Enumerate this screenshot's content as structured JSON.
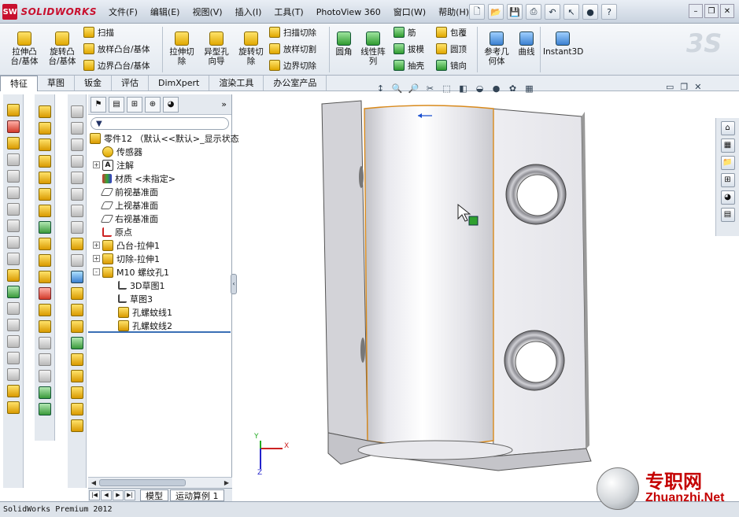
{
  "app": {
    "logo_text": "SOLIDWORKS",
    "logo_mark": "SW",
    "status": "SolidWorks Premium 2012"
  },
  "menu": [
    "文件(F)",
    "编辑(E)",
    "视图(V)",
    "插入(I)",
    "工具(T)",
    "PhotoView 360",
    "窗口(W)",
    "帮助(H)"
  ],
  "ribbon": {
    "extrude_boss": "拉伸凸\n台/基体",
    "revolve_boss": "旋转凸\n台/基体",
    "sweep": "扫描",
    "loft_boss": "放样凸台/基体",
    "boundary_boss": "边界凸台/基体",
    "extrude_cut": "拉伸切\n除",
    "hole_wizard": "异型孔\n向导",
    "revolve_cut": "旋转切\n除",
    "swept_cut": "扫描切除",
    "lofted_cut": "放样切割",
    "boundary_cut": "边界切除",
    "fillet": "圆角",
    "linear_pattern": "线性阵\n列",
    "rib": "筋",
    "draft": "拔模",
    "shell": "抽壳",
    "wrap": "包覆",
    "dome": "圆顶",
    "mirror": "镜向",
    "ref_geometry": "参考几\n何体",
    "curves": "曲线",
    "instant3d": "Instant3D"
  },
  "tabs": [
    "特征",
    "草图",
    "钣金",
    "评估",
    "DimXpert",
    "渲染工具",
    "办公室产品"
  ],
  "tree": {
    "root": "零件12 （默认<<默认>_显示状态",
    "items": [
      {
        "label": "传感器",
        "icon": "sensor-icon",
        "expander": ""
      },
      {
        "label": "注解",
        "icon": "annotation-icon",
        "expander": "+"
      },
      {
        "label": "材质 <未指定>",
        "icon": "material-icon",
        "expander": ""
      },
      {
        "label": "前视基准面",
        "icon": "plane-icon",
        "expander": ""
      },
      {
        "label": "上视基准面",
        "icon": "plane-icon",
        "expander": ""
      },
      {
        "label": "右视基准面",
        "icon": "plane-icon",
        "expander": ""
      },
      {
        "label": "原点",
        "icon": "origin-icon",
        "expander": ""
      },
      {
        "label": "凸台-拉伸1",
        "icon": "boss-extrude-icon",
        "expander": "+"
      },
      {
        "label": "切除-拉伸1",
        "icon": "cut-extrude-icon",
        "expander": "+"
      },
      {
        "label": "M10 螺纹孔1",
        "icon": "hole-icon",
        "expander": "-"
      }
    ],
    "children": [
      {
        "label": "3D草图1",
        "icon": "3dsketch-icon"
      },
      {
        "label": "草图3",
        "icon": "sketch-icon"
      },
      {
        "label": "孔螺蚊线1",
        "icon": "thread-icon"
      },
      {
        "label": "孔螺蚊线2",
        "icon": "thread-icon"
      }
    ]
  },
  "bottom_tabs": [
    "模型",
    "运动算例 1"
  ],
  "watermark": {
    "cn": "专职网",
    "en": "Zhuanzhi.Net"
  },
  "triad": {
    "x": "X",
    "y": "Y",
    "z": "Z"
  },
  "colors": {
    "accent": "#c8102e",
    "select": "#2fa02f",
    "edge": "#d98a1c"
  }
}
